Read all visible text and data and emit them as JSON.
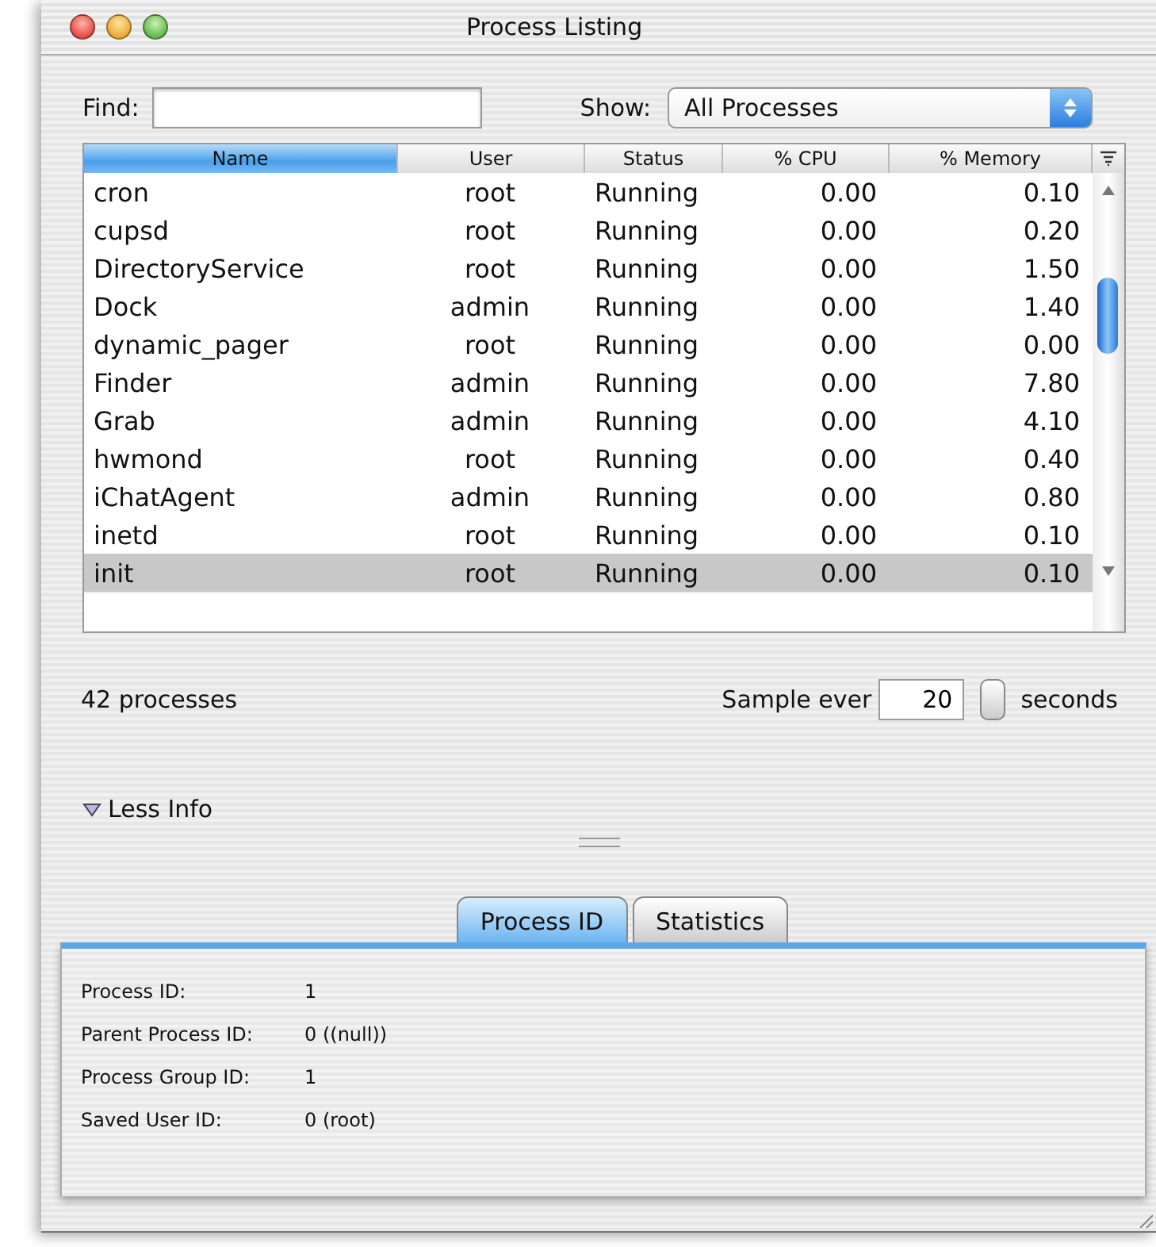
{
  "window": {
    "title": "Process Listing"
  },
  "find": {
    "label": "Find:"
  },
  "show": {
    "label": "Show:",
    "value": "All Processes"
  },
  "table": {
    "columns": [
      {
        "label": "Name",
        "selected": true
      },
      {
        "label": "User",
        "selected": false
      },
      {
        "label": "Status",
        "selected": false
      },
      {
        "label": "% CPU",
        "selected": false
      },
      {
        "label": "% Memory",
        "selected": false
      }
    ],
    "rows": [
      {
        "cells": [
          "cron",
          "root",
          "Running",
          "0.00",
          "0.10"
        ],
        "selected": false
      },
      {
        "cells": [
          "cupsd",
          "root",
          "Running",
          "0.00",
          "0.20"
        ],
        "selected": false
      },
      {
        "cells": [
          "DirectoryService",
          "root",
          "Running",
          "0.00",
          "1.50"
        ],
        "selected": false
      },
      {
        "cells": [
          "Dock",
          "admin",
          "Running",
          "0.00",
          "1.40"
        ],
        "selected": false
      },
      {
        "cells": [
          "dynamic_pager",
          "root",
          "Running",
          "0.00",
          "0.00"
        ],
        "selected": false
      },
      {
        "cells": [
          "Finder",
          "admin",
          "Running",
          "0.00",
          "7.80"
        ],
        "selected": false
      },
      {
        "cells": [
          "Grab",
          "admin",
          "Running",
          "0.00",
          "4.10"
        ],
        "selected": false
      },
      {
        "cells": [
          "hwmond",
          "root",
          "Running",
          "0.00",
          "0.40"
        ],
        "selected": false
      },
      {
        "cells": [
          "iChatAgent",
          "admin",
          "Running",
          "0.00",
          "0.80"
        ],
        "selected": false
      },
      {
        "cells": [
          "inetd",
          "root",
          "Running",
          "0.00",
          "0.10"
        ],
        "selected": false
      },
      {
        "cells": [
          "init",
          "root",
          "Running",
          "0.00",
          "0.10"
        ],
        "selected": true
      }
    ]
  },
  "status": {
    "count": "42 processes",
    "sample_label": "Sample ever",
    "sample_value": "20",
    "sample_unit": "seconds"
  },
  "disclosure": {
    "label": "Less Info",
    "expanded": true
  },
  "tabs": [
    {
      "label": "Process ID",
      "selected": true
    },
    {
      "label": "Statistics",
      "selected": false
    }
  ],
  "details": [
    {
      "label": "Process ID:",
      "value": "1"
    },
    {
      "label": "Parent Process ID:",
      "value": "0 ((null))"
    },
    {
      "label": "Process Group ID:",
      "value": "1"
    },
    {
      "label": "Saved User ID:",
      "value": "0 (root)"
    }
  ]
}
